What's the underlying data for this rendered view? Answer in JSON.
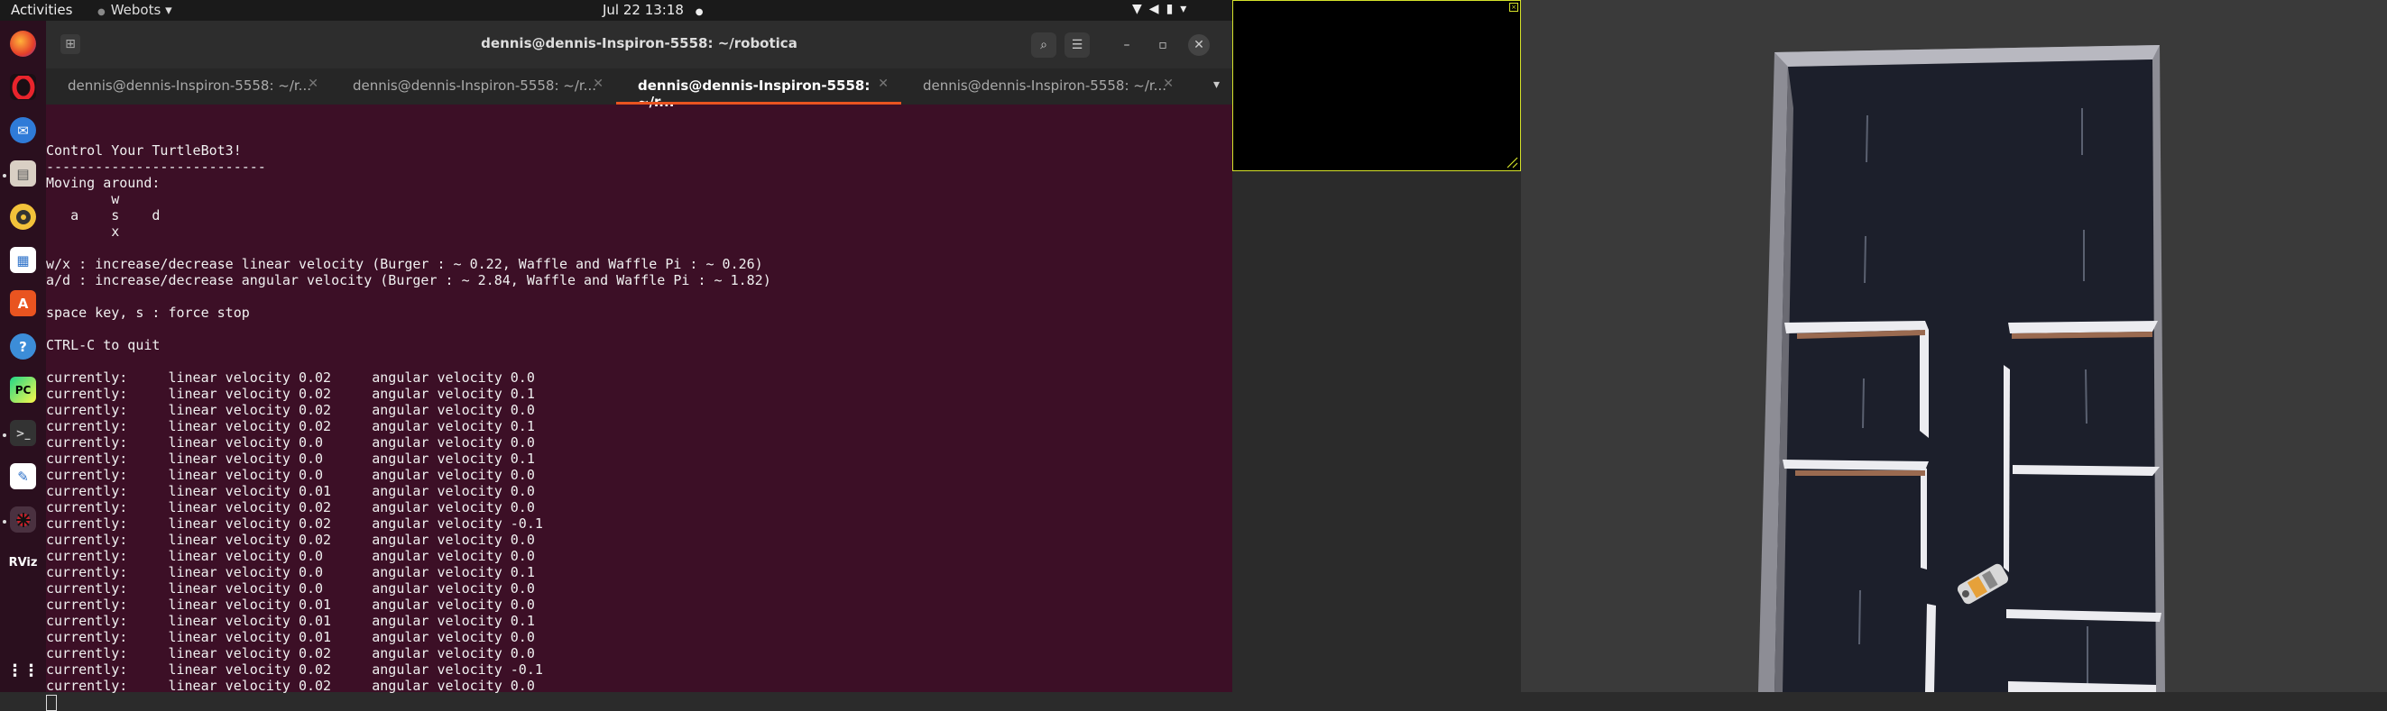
{
  "topbar": {
    "activities": "Activities",
    "app_name": "Webots",
    "app_caret": "▾",
    "clock": "Jul 22  13:18",
    "record_indicator": "●",
    "tray_icons": [
      "wifi-icon",
      "volume-icon",
      "battery-icon",
      "chevron-down-icon"
    ]
  },
  "dock": {
    "items": [
      "firefox",
      "opera",
      "thunderbird",
      "files",
      "rhythmbox",
      "libreoffice-writer",
      "software-center",
      "help",
      "pycharm",
      "terminal",
      "text-editor",
      "webots",
      "rviz",
      "show-applications"
    ],
    "rviz_label": "RViz"
  },
  "terminal": {
    "title": "dennis@dennis-Inspiron-5558: ~/robotica",
    "tabs": [
      {
        "label": "dennis@dennis-Inspiron-5558: ~/r...",
        "active": false
      },
      {
        "label": "dennis@dennis-Inspiron-5558: ~/r...",
        "active": false
      },
      {
        "label": "dennis@dennis-Inspiron-5558: ~/r...",
        "active": true
      },
      {
        "label": "dennis@dennis-Inspiron-5558: ~/r...",
        "active": false
      }
    ],
    "header_lines": [
      "",
      "Control Your TurtleBot3!",
      "---------------------------",
      "Moving around:",
      "        w",
      "   a    s    d",
      "        x",
      "",
      "w/x : increase/decrease linear velocity (Burger : ~ 0.22, Waffle and Waffle Pi : ~ 0.26)",
      "a/d : increase/decrease angular velocity (Burger : ~ 2.84, Waffle and Waffle Pi : ~ 1.82)",
      "",
      "space key, s : force stop",
      "",
      "CTRL-C to quit",
      ""
    ],
    "status_rows": [
      {
        "linear": "0.02",
        "angular": "0.0"
      },
      {
        "linear": "0.02",
        "angular": "0.1"
      },
      {
        "linear": "0.02",
        "angular": "0.0"
      },
      {
        "linear": "0.02",
        "angular": "0.1"
      },
      {
        "linear": "0.0",
        "angular": "0.0"
      },
      {
        "linear": "0.0",
        "angular": "0.1"
      },
      {
        "linear": "0.0",
        "angular": "0.0"
      },
      {
        "linear": "0.01",
        "angular": "0.0"
      },
      {
        "linear": "0.02",
        "angular": "0.0"
      },
      {
        "linear": "0.02",
        "angular": "-0.1"
      },
      {
        "linear": "0.02",
        "angular": "0.0"
      },
      {
        "linear": "0.0",
        "angular": "0.0"
      },
      {
        "linear": "0.0",
        "angular": "0.1"
      },
      {
        "linear": "0.0",
        "angular": "0.0"
      },
      {
        "linear": "0.01",
        "angular": "0.0"
      },
      {
        "linear": "0.01",
        "angular": "0.1"
      },
      {
        "linear": "0.01",
        "angular": "0.0"
      },
      {
        "linear": "0.02",
        "angular": "0.0"
      },
      {
        "linear": "0.02",
        "angular": "-0.1"
      },
      {
        "linear": "0.02",
        "angular": "0.0"
      }
    ],
    "row_prefix": "currently:",
    "linear_label": "linear velocity",
    "angular_label": "angular velocity"
  },
  "colors": {
    "terminal_bg": "#3c0f26",
    "dock_bg": "#2a0f1e",
    "tab_accent": "#e95420",
    "camera_border": "#d6e32a",
    "scene_bg": "#3a3a3a",
    "maze_floor": "#1c1f2b",
    "maze_wall": "#ececf0"
  }
}
